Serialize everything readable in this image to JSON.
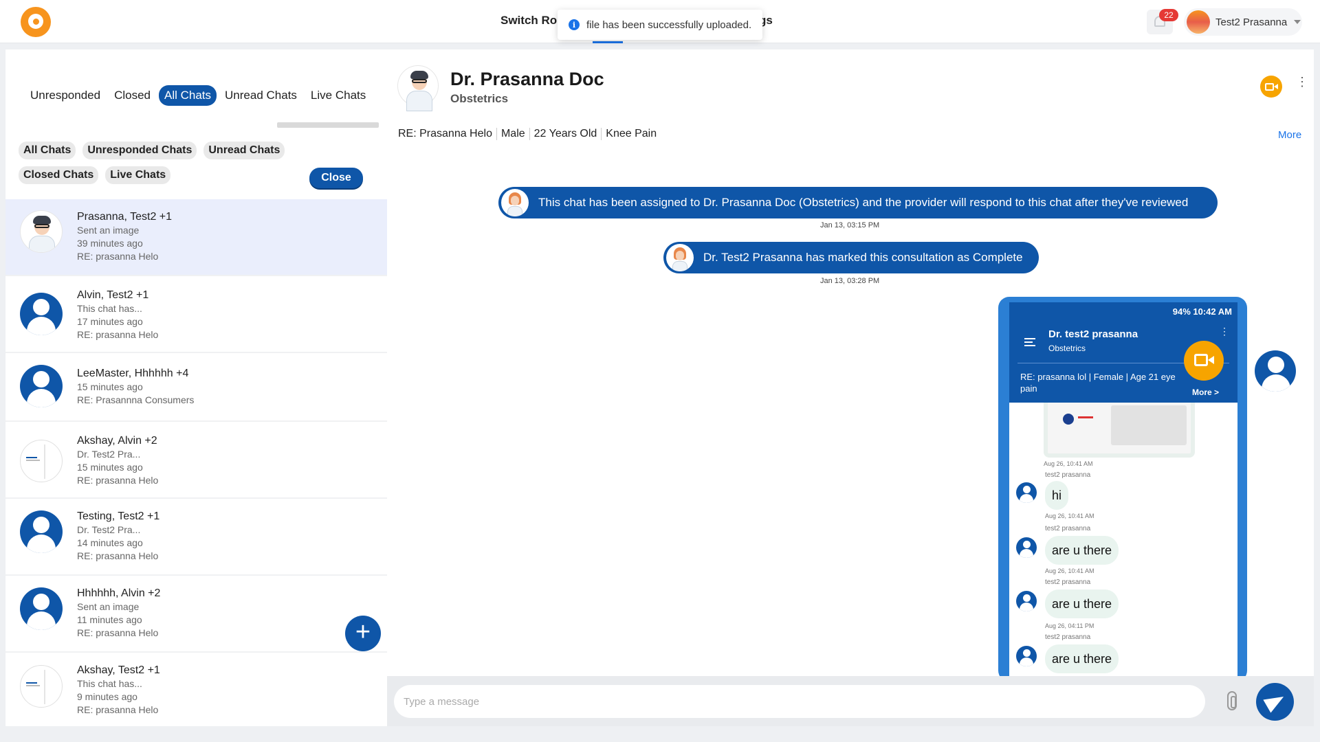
{
  "topbar": {
    "nav_left": "Switch Role",
    "nav_right_partial": "gs",
    "toast": "file has been successfully uploaded.",
    "notification_count": "22",
    "user_name": "Test2 Prasanna"
  },
  "sidebar": {
    "tabs": [
      {
        "label": "Unresponded",
        "active": false
      },
      {
        "label": "Closed",
        "active": false
      },
      {
        "label": "All Chats",
        "active": true
      },
      {
        "label": "Unread Chats",
        "active": false
      },
      {
        "label": "Live Chats",
        "active": false
      }
    ],
    "filters_row1": [
      "All Chats",
      "Unresponded Chats",
      "Unread Chats"
    ],
    "filters_row2": [
      "Closed Chats",
      "Live Chats"
    ],
    "close_label": "Close",
    "chats": [
      {
        "name": "Prasanna, Test2 +1",
        "lines": [
          "Sent an image",
          "39 minutes ago",
          "RE: prasanna Helo"
        ],
        "avatar": "doctor",
        "selected": true
      },
      {
        "name": "Alvin, Test2 +1",
        "lines": [
          "This chat has...",
          "17 minutes ago",
          "RE: prasanna Helo"
        ],
        "avatar": "person"
      },
      {
        "name": "LeeMaster, Hhhhhh +4",
        "lines": [
          "15 minutes ago",
          "RE: Prasannna Consumers"
        ],
        "avatar": "person"
      },
      {
        "name": "Akshay, Alvin +2",
        "lines": [
          "Dr. Test2 Pra...",
          "15 minutes ago",
          "RE: prasanna Helo"
        ],
        "avatar": "image"
      },
      {
        "name": "Testing, Test2 +1",
        "lines": [
          "Dr. Test2 Pra...",
          "14 minutes ago",
          "RE: prasanna Helo"
        ],
        "avatar": "person"
      },
      {
        "name": "Hhhhhh, Alvin +2",
        "lines": [
          "Sent an image",
          "11 minutes ago",
          "RE: prasanna Helo"
        ],
        "avatar": "person"
      },
      {
        "name": "Akshay, Test2 +1",
        "lines": [
          "This chat has...",
          "9 minutes ago",
          "RE: prasanna Helo"
        ],
        "avatar": "image"
      }
    ],
    "fab_label": "+"
  },
  "conversation": {
    "doctor_name": "Dr. Prasanna Doc",
    "specialty": "Obstetrics",
    "re_parts": [
      "RE: Prasanna Helo",
      "Male",
      "22 Years Old",
      "Knee Pain"
    ],
    "more_label": "More",
    "system_messages": [
      {
        "text": "This chat has been assigned to Dr. Prasanna Doc (Obstetrics) and the provider will respond to this chat after they've reviewed",
        "time": "Jan 13, 03:15 PM"
      },
      {
        "text": "Dr. Test2 Prasanna has marked this consultation as Complete",
        "time": "Jan 13, 03:28 PM"
      }
    ],
    "screenshot": {
      "status": "94%  10:42 AM",
      "name": "Dr. test2 prasanna",
      "specialty": "Obstetrics",
      "re": "RE: prasanna lol | Female | Age 21 eye pain",
      "more": "More >",
      "first_time": "Aug 26, 10:41 AM",
      "messages": [
        {
          "sender": "test2 prasanna",
          "text": "hi",
          "time": "Aug 26, 10:41 AM"
        },
        {
          "sender": "test2 prasanna",
          "text": "are u there",
          "time": "Aug 26, 10:41 AM"
        },
        {
          "sender": "test2 prasanna",
          "text": "are u there",
          "time": "Aug 26, 04:11 PM"
        },
        {
          "sender": "test2 prasanna",
          "text": "are u there",
          "time": ""
        }
      ]
    },
    "composer_placeholder": "Type a message"
  },
  "colors": {
    "primary": "#0f56a8",
    "accent": "#f7a400",
    "badge": "#e53935"
  }
}
